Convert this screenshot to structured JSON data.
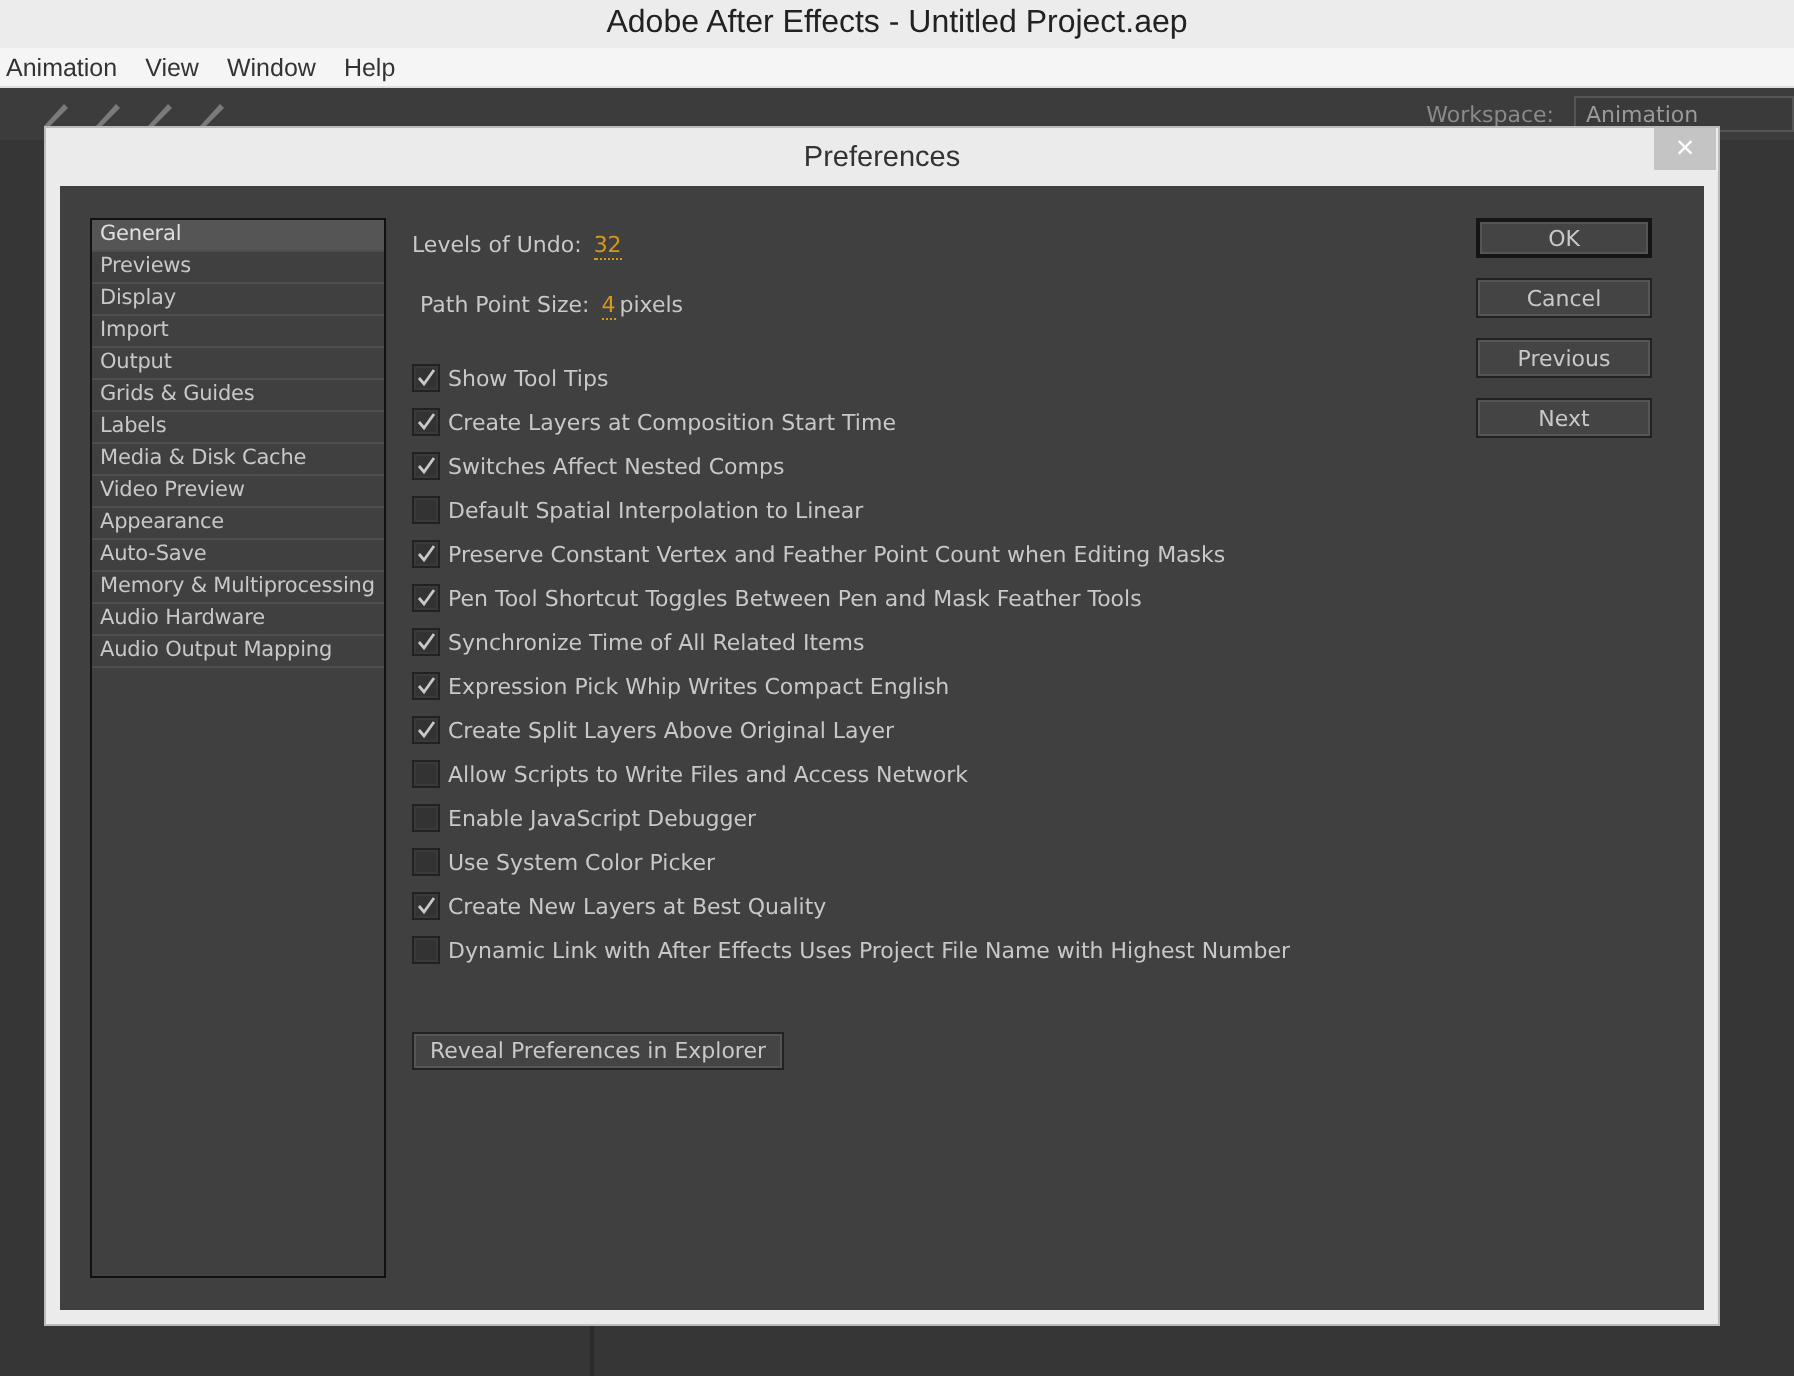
{
  "window": {
    "title": "Adobe After Effects - Untitled Project.aep"
  },
  "menu": [
    "Animation",
    "View",
    "Window",
    "Help"
  ],
  "toolbar": {
    "workspace_label": "Workspace:",
    "workspace_value": "Animation"
  },
  "dialog": {
    "title": "Preferences",
    "close": "×",
    "categories": [
      {
        "label": "General",
        "selected": true
      },
      {
        "label": "Previews",
        "selected": false
      },
      {
        "label": "Display",
        "selected": false
      },
      {
        "label": "Import",
        "selected": false
      },
      {
        "label": "Output",
        "selected": false
      },
      {
        "label": "Grids & Guides",
        "selected": false
      },
      {
        "label": "Labels",
        "selected": false
      },
      {
        "label": "Media & Disk Cache",
        "selected": false
      },
      {
        "label": "Video Preview",
        "selected": false
      },
      {
        "label": "Appearance",
        "selected": false
      },
      {
        "label": "Auto-Save",
        "selected": false
      },
      {
        "label": "Memory & Multiprocessing",
        "selected": false
      },
      {
        "label": "Audio Hardware",
        "selected": false
      },
      {
        "label": "Audio Output Mapping",
        "selected": false
      }
    ],
    "levels_of_undo": {
      "label": "Levels of Undo:",
      "value": "32"
    },
    "path_point_size": {
      "label": "Path Point Size:",
      "value": "4",
      "unit": "pixels"
    },
    "options": [
      {
        "label": "Show Tool Tips",
        "checked": true
      },
      {
        "label": "Create Layers at Composition Start Time",
        "checked": true
      },
      {
        "label": "Switches Affect Nested Comps",
        "checked": true
      },
      {
        "label": "Default Spatial Interpolation to Linear",
        "checked": false
      },
      {
        "label": "Preserve Constant Vertex and Feather Point Count when Editing Masks",
        "checked": true
      },
      {
        "label": "Pen Tool Shortcut Toggles Between Pen and Mask Feather Tools",
        "checked": true
      },
      {
        "label": "Synchronize Time of All Related Items",
        "checked": true
      },
      {
        "label": "Expression Pick Whip Writes Compact English",
        "checked": true
      },
      {
        "label": "Create Split Layers Above Original Layer",
        "checked": true
      },
      {
        "label": "Allow Scripts to Write Files and Access Network",
        "checked": false
      },
      {
        "label": "Enable JavaScript Debugger",
        "checked": false
      },
      {
        "label": "Use System Color Picker",
        "checked": false
      },
      {
        "label": "Create New Layers at Best Quality",
        "checked": true
      },
      {
        "label": "Dynamic Link with After Effects Uses Project File Name with Highest Number",
        "checked": false
      }
    ],
    "reveal_button": "Reveal Preferences in Explorer",
    "buttons": [
      {
        "label": "OK",
        "default": true
      },
      {
        "label": "Cancel",
        "default": false
      },
      {
        "label": "Previous",
        "default": false
      },
      {
        "label": "Next",
        "default": false
      }
    ]
  }
}
